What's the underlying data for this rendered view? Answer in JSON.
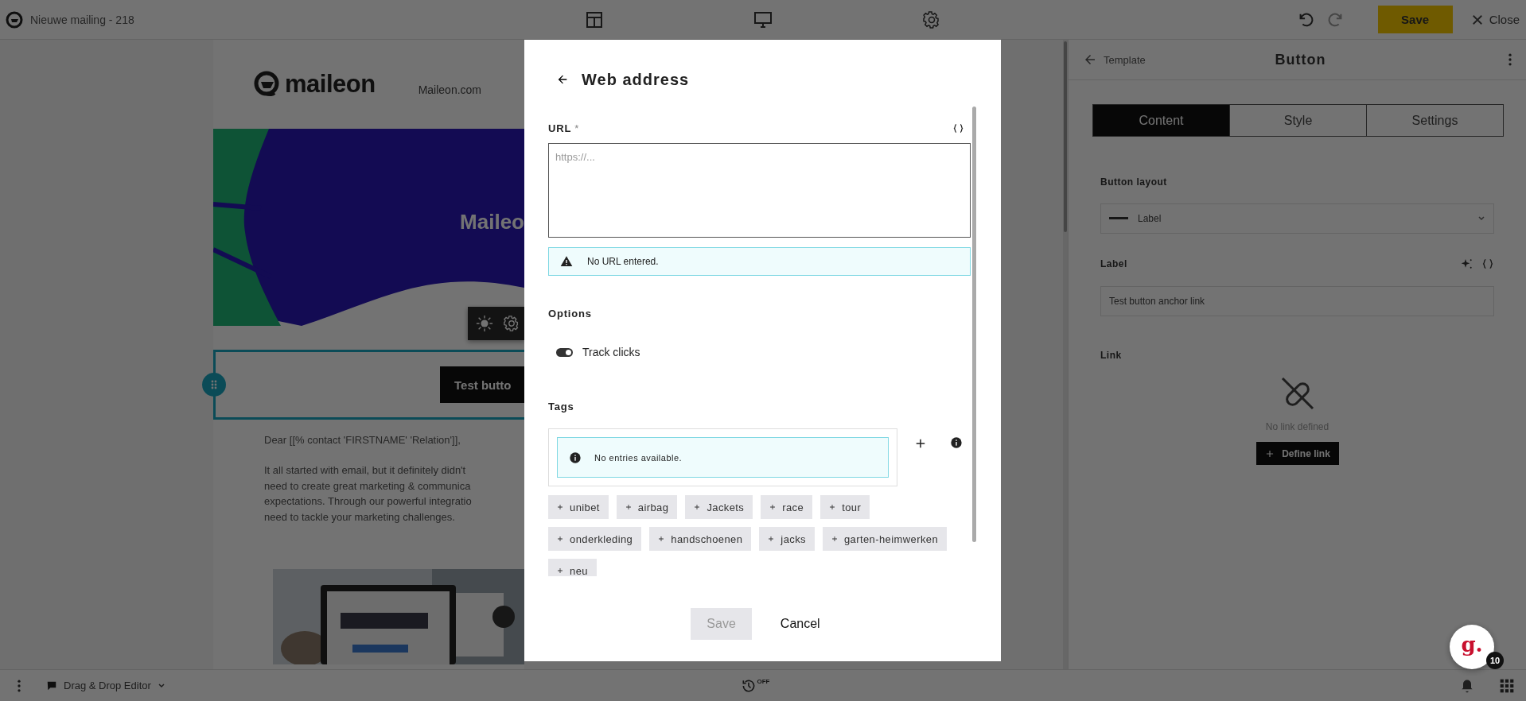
{
  "top_bar": {
    "title": "Nieuwe mailing - 218",
    "save": "Save",
    "close": "Close"
  },
  "email": {
    "logo_text": "maileon",
    "nav_link": "Maileon.com",
    "banner_text": "Maileo",
    "button_label": "Test butto",
    "greeting": "Dear [[% contact 'FIRSTNAME' 'Relation']],",
    "paragraph_lines": [
      "It all started with email, but it definitely didn't",
      "need to create great marketing & communica",
      "expectations. Through our powerful integratio",
      "need to tackle your marketing challenges."
    ]
  },
  "right_panel": {
    "back": "Template",
    "title": "Button",
    "tabs": [
      {
        "label": "Content",
        "selected": true
      },
      {
        "label": "Style",
        "selected": false
      },
      {
        "label": "Settings",
        "selected": false
      }
    ],
    "layout_heading": "Button layout",
    "layout_value": "Label",
    "label_heading": "Label",
    "label_value": "Test button anchor link",
    "link_heading": "Link",
    "no_link": "No link defined",
    "define_link": "Define link"
  },
  "dialog": {
    "title": "Web address",
    "url_label": "URL",
    "url_required_mark": "*",
    "url_placeholder": "https://...",
    "url_warning": "No URL entered.",
    "options_heading": "Options",
    "options": [
      {
        "label": "Track clicks",
        "on": true
      }
    ],
    "tags_heading": "Tags",
    "tags_empty": "No entries available.",
    "suggested_tags": [
      "unibet",
      "airbag",
      "Jackets",
      "race",
      "tour",
      "onderkleding",
      "handschoenen",
      "jacks",
      "garten-heimwerken",
      "neu"
    ],
    "save": {
      "label": "Save",
      "disabled": true
    },
    "cancel": "Cancel"
  },
  "bottom_bar": {
    "editor": "Drag & Drop Editor",
    "autosave": "OFF"
  },
  "help": {
    "logo": "g.",
    "count": "10"
  }
}
